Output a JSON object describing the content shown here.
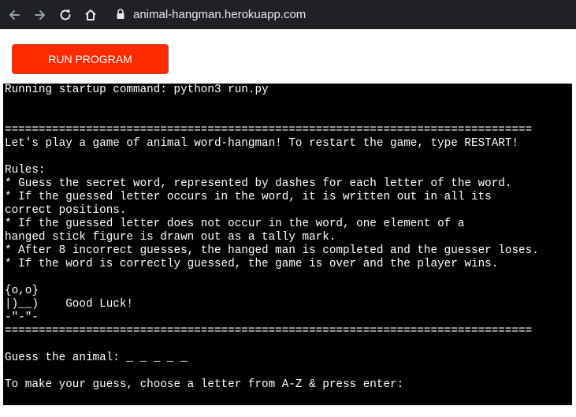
{
  "browser": {
    "url": "animal-hangman.herokuapp.com",
    "icons": [
      "back-icon",
      "forward-icon",
      "reload-icon",
      "home-icon",
      "lock-icon"
    ]
  },
  "run_button": {
    "label": "RUN PROGRAM",
    "color": "#ff2a00"
  },
  "terminal": {
    "lines": [
      "Running startup command: python3 run.py",
      "",
      "",
      "==============================================================================",
      "Let's play a game of animal word-hangman! To restart the game, type RESTART!",
      "",
      "Rules:",
      "* Guess the secret word, represented by dashes for each letter of the word.",
      "* If the guessed letter occurs in the word, it is written out in all its",
      "correct positions.",
      "* If the guessed letter does not occur in the word, one element of a",
      "hanged stick figure is drawn out as a tally mark.",
      "* After 8 incorrect guesses, the hanged man is completed and the guesser loses.",
      "* If the word is correctly guessed, the game is over and the player wins.",
      "",
      "{o,o}",
      "|)__)    Good Luck!",
      "-\"-\"-",
      "==============================================================================",
      "",
      "Guess the animal: _ _ _ _ _",
      "",
      "To make your guess, choose a letter from A-Z & press enter:"
    ]
  }
}
